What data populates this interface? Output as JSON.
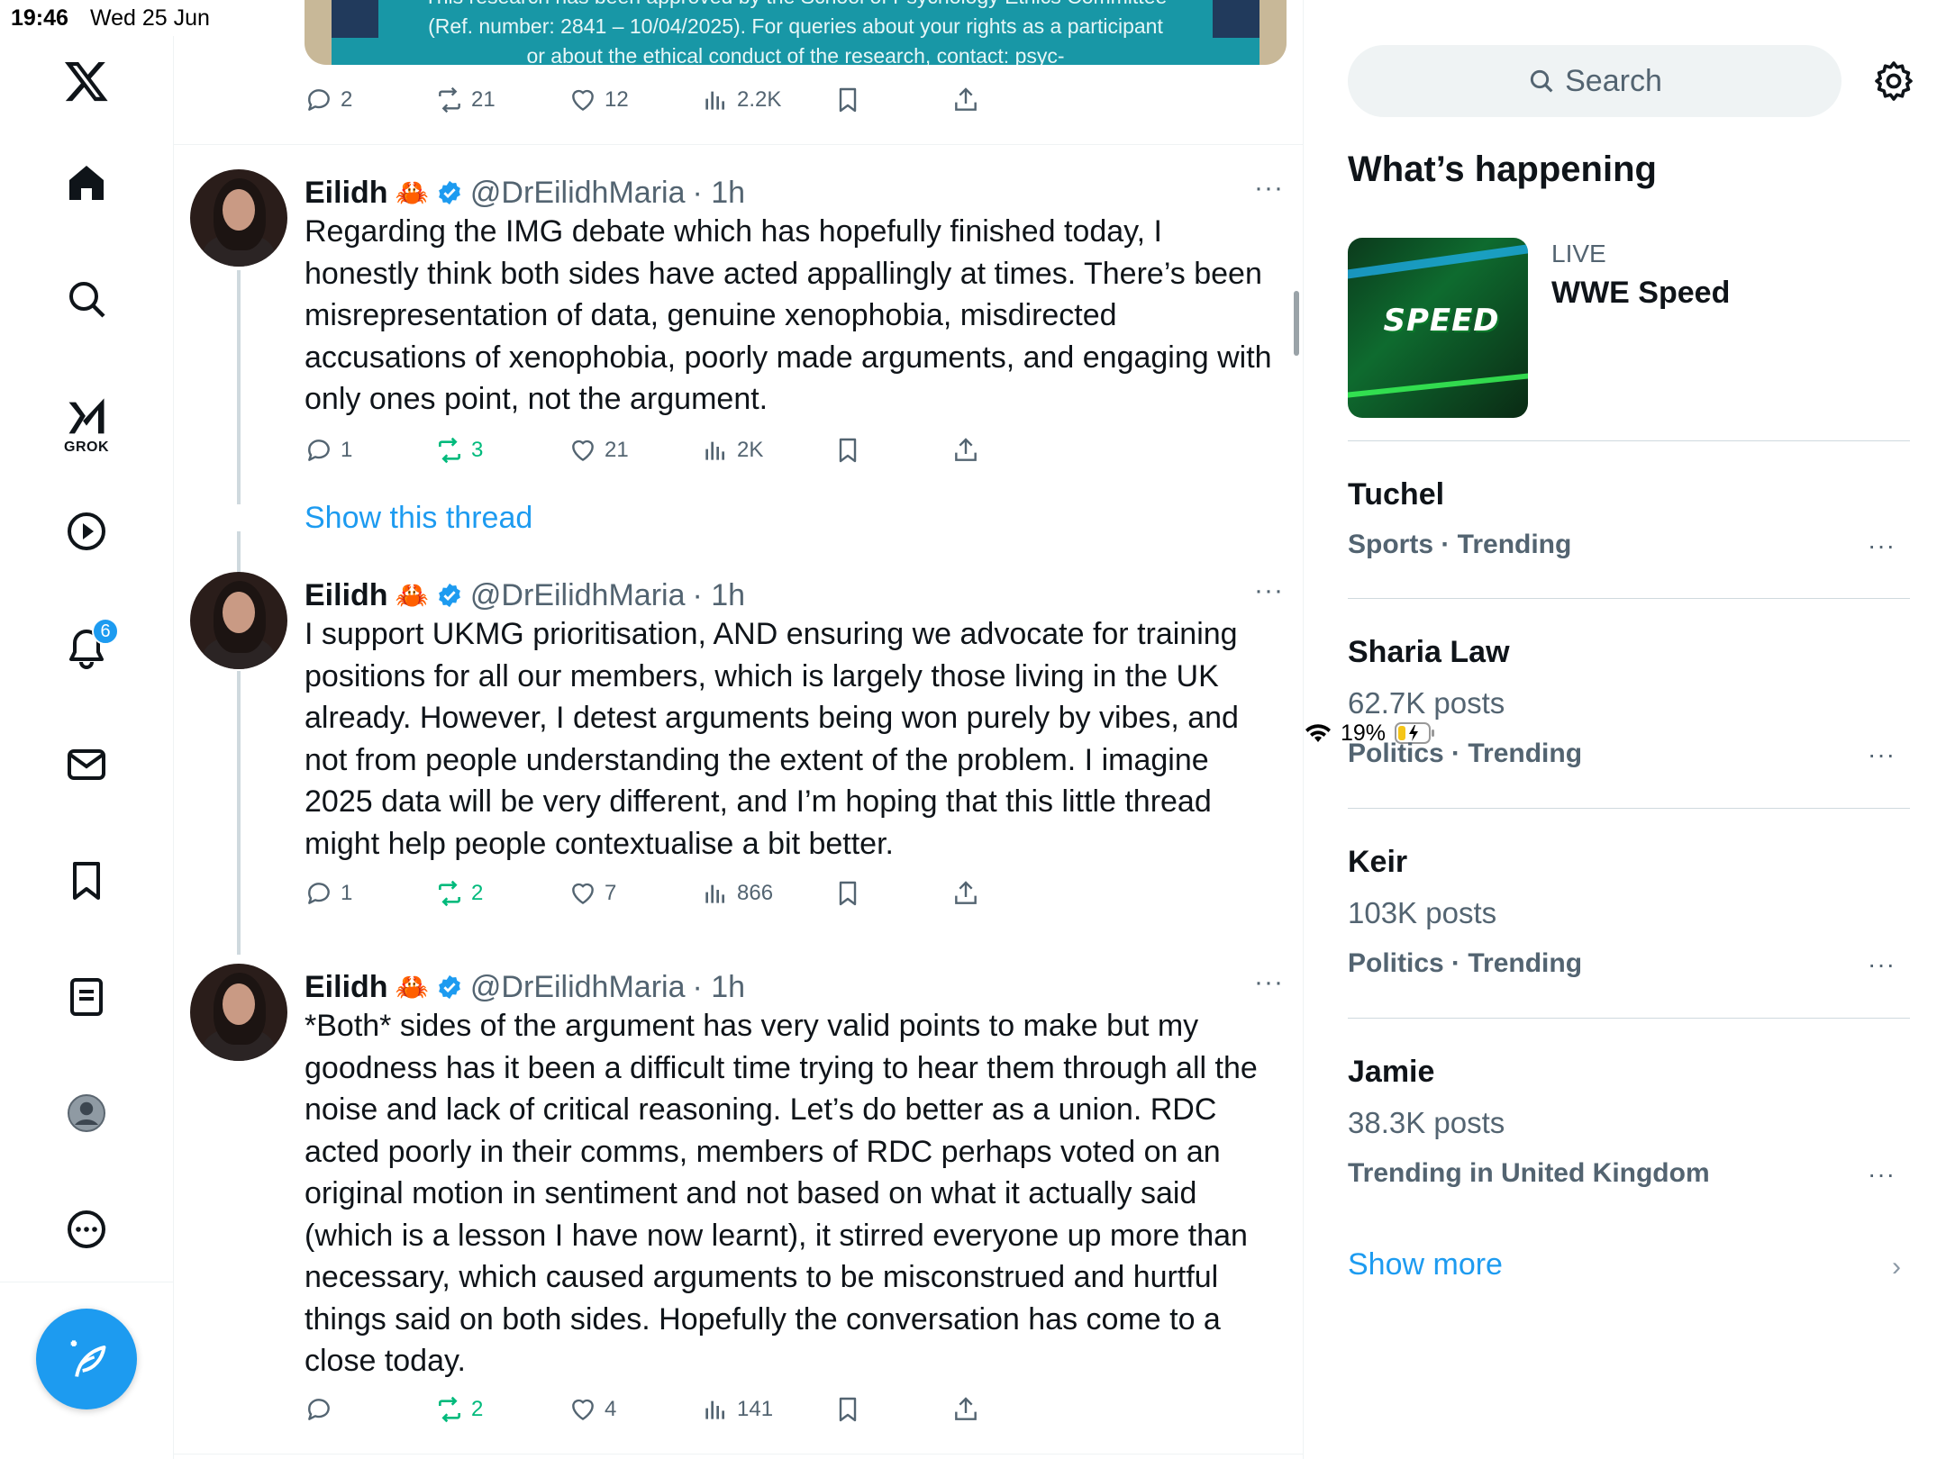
{
  "status_bar": {
    "time": "19:46",
    "date": "Wed 25 Jun",
    "battery": "19%"
  },
  "nav": {
    "grok_label": "GROK",
    "notifications_badge": "6"
  },
  "top_media": {
    "line1": "This research has been approved by the School of Psychology Ethics Committee",
    "line2": "(Ref. number: 2841 – 10/04/2025). For queries about your rights as a participant",
    "line3": "or about the ethical conduct of the research, contact: psyc-"
  },
  "top_actions": {
    "replies": "2",
    "reposts": "21",
    "likes": "12",
    "views": "2.2K"
  },
  "tweets": [
    {
      "name": "Eilidh",
      "emoji": "🦀",
      "handle": "@DrEilidhMaria",
      "time": "· 1h",
      "lines": [
        "Regarding the IMG debate which has hopefully finished today, I",
        "honestly think both sides have acted appallingly at times. There’s been",
        "misrepresentation of data, genuine xenophobia, misdirected",
        "accusations of xenophobia, poorly made arguments, and engaging with",
        "only ones point, not the argument."
      ],
      "replies": "1",
      "reposts": "3",
      "likes": "21",
      "views": "2K"
    },
    {
      "name": "Eilidh",
      "emoji": "🦀",
      "handle": "@DrEilidhMaria",
      "time": "· 1h",
      "lines": [
        "I support UKMG prioritisation, AND ensuring we advocate for training",
        "positions for all our members, which is largely those living in the UK",
        "already. However, I detest arguments being won purely by vibes, and",
        "not from people understanding the extent of the problem. I imagine",
        "2025 data will be very different, and I’m hoping that this little thread",
        "might help people contextualise a bit better."
      ],
      "replies": "1",
      "reposts": "2",
      "likes": "7",
      "views": "866"
    },
    {
      "name": "Eilidh",
      "emoji": "🦀",
      "handle": "@DrEilidhMaria",
      "time": "· 1h",
      "lines": [
        "*Both* sides of the argument has very valid points to make but my",
        "goodness has it been a difficult time trying to hear them through all the",
        "noise and lack of critical reasoning. Let’s do better as a union. RDC",
        "acted poorly in their comms, members of RDC perhaps voted on an",
        "original motion in sentiment and not based on what it actually said",
        "(which is a lesson I have now learnt), it stirred everyone up more than",
        "necessary, which caused arguments to be misconstrued and hurtful",
        "things said on both sides. Hopefully the conversation has come to a",
        "close today."
      ],
      "replies": "",
      "reposts": "2",
      "likes": "4",
      "views": "141"
    }
  ],
  "show_thread": "Show this thread",
  "sidebar": {
    "search_placeholder": "Search",
    "whats_happening": "What’s happening",
    "live": {
      "label": "LIVE",
      "title": "WWE Speed",
      "thumb_text": "SPEED"
    },
    "trends": [
      {
        "title": "Tuchel",
        "posts": "",
        "category": "Sports · Trending"
      },
      {
        "title": "Sharia Law",
        "posts": "62.7K posts",
        "category": "Politics · Trending"
      },
      {
        "title": "Keir",
        "posts": "103K posts",
        "category": "Politics · Trending"
      },
      {
        "title": "Jamie",
        "posts": "38.3K posts",
        "category": "Trending in United Kingdom"
      }
    ],
    "show_more": "Show more"
  },
  "colors": {
    "accent": "#1d9bf0",
    "repost_active": "#00ba7c",
    "secondary_text": "#536471"
  }
}
